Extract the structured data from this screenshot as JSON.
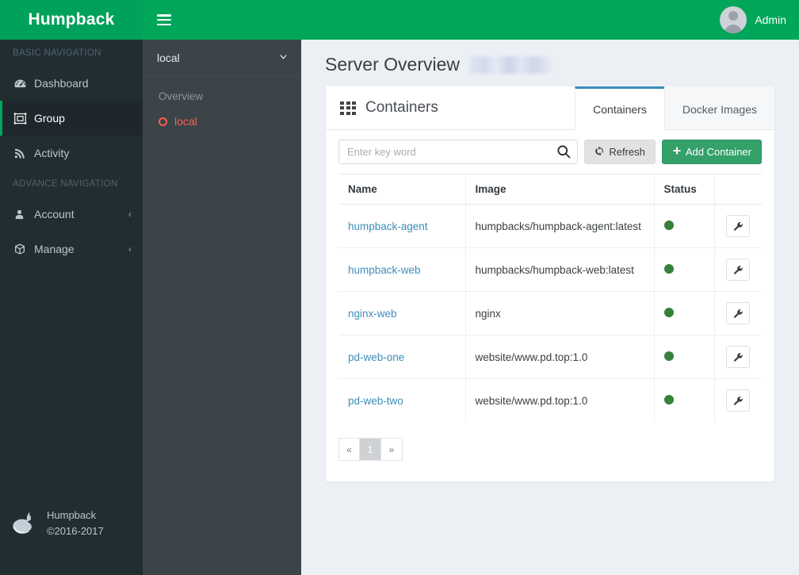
{
  "header": {
    "brand": "Humpback",
    "menu_icon": "hamburger-icon",
    "user_name": "Admin"
  },
  "sidebar": {
    "sections": [
      {
        "label": "BASIC NAVIGATION"
      },
      {
        "label": "ADVANCE NAVIGATION"
      }
    ],
    "basic_items": [
      {
        "label": "Dashboard",
        "icon": "tachometer-icon",
        "active": false,
        "chevron": ""
      },
      {
        "label": "Group",
        "icon": "object-group-icon",
        "active": true,
        "chevron": ""
      },
      {
        "label": "Activity",
        "icon": "rss-icon",
        "active": false,
        "chevron": ""
      }
    ],
    "advance_items": [
      {
        "label": "Account",
        "icon": "user-icon",
        "active": false,
        "chevron": "‹"
      },
      {
        "label": "Manage",
        "icon": "cube-icon",
        "active": false,
        "chevron": "‹"
      }
    ],
    "footer": {
      "name": "Humpback",
      "copyright": "©2016-2017",
      "logo": "whale-logo"
    }
  },
  "subsidebar": {
    "selected": "local",
    "caret": "chevron-down-icon",
    "group_label": "Overview",
    "item": "local"
  },
  "main": {
    "page_title": "Server Overview",
    "redacted_badge": "",
    "panel_title": "Containers",
    "panel_icon": "grid-icon",
    "tabs": [
      {
        "label": "Containers",
        "active": true
      },
      {
        "label": "Docker Images",
        "active": false
      }
    ],
    "search": {
      "placeholder": "Enter key word",
      "value": "",
      "icon": "search-icon"
    },
    "buttons": {
      "refresh": "Refresh",
      "refresh_icon": "refresh-icon",
      "add_container": "Add Container",
      "add_icon": "plus-icon"
    },
    "table": {
      "columns": [
        "Name",
        "Image",
        "Status",
        ""
      ],
      "rows": [
        {
          "name": "humpback-agent",
          "image": "humpbacks/humpback-agent:latest",
          "status": "running",
          "action": "wrench-icon"
        },
        {
          "name": "humpback-web",
          "image": "humpbacks/humpback-web:latest",
          "status": "running",
          "action": "wrench-icon"
        },
        {
          "name": "nginx-web",
          "image": "nginx",
          "status": "running",
          "action": "wrench-icon"
        },
        {
          "name": "pd-web-one",
          "image": "website/www.pd.top:1.0",
          "status": "running",
          "action": "wrench-icon"
        },
        {
          "name": "pd-web-two",
          "image": "website/www.pd.top:1.0",
          "status": "running",
          "action": "wrench-icon"
        }
      ]
    },
    "pagination": {
      "prev": "«",
      "pages": [
        "1"
      ],
      "next": "»",
      "current": "1"
    }
  },
  "colors": {
    "brand_green": "#00a65a",
    "sidebar_dark": "#222d32",
    "subbar_dark": "#3b4449",
    "accent_blue": "#3c8dbc",
    "link_blue": "#3c8dbc",
    "status_green": "#35803a",
    "sub_item_red": "#ff5f4a",
    "content_bg": "#ecf0f5"
  }
}
